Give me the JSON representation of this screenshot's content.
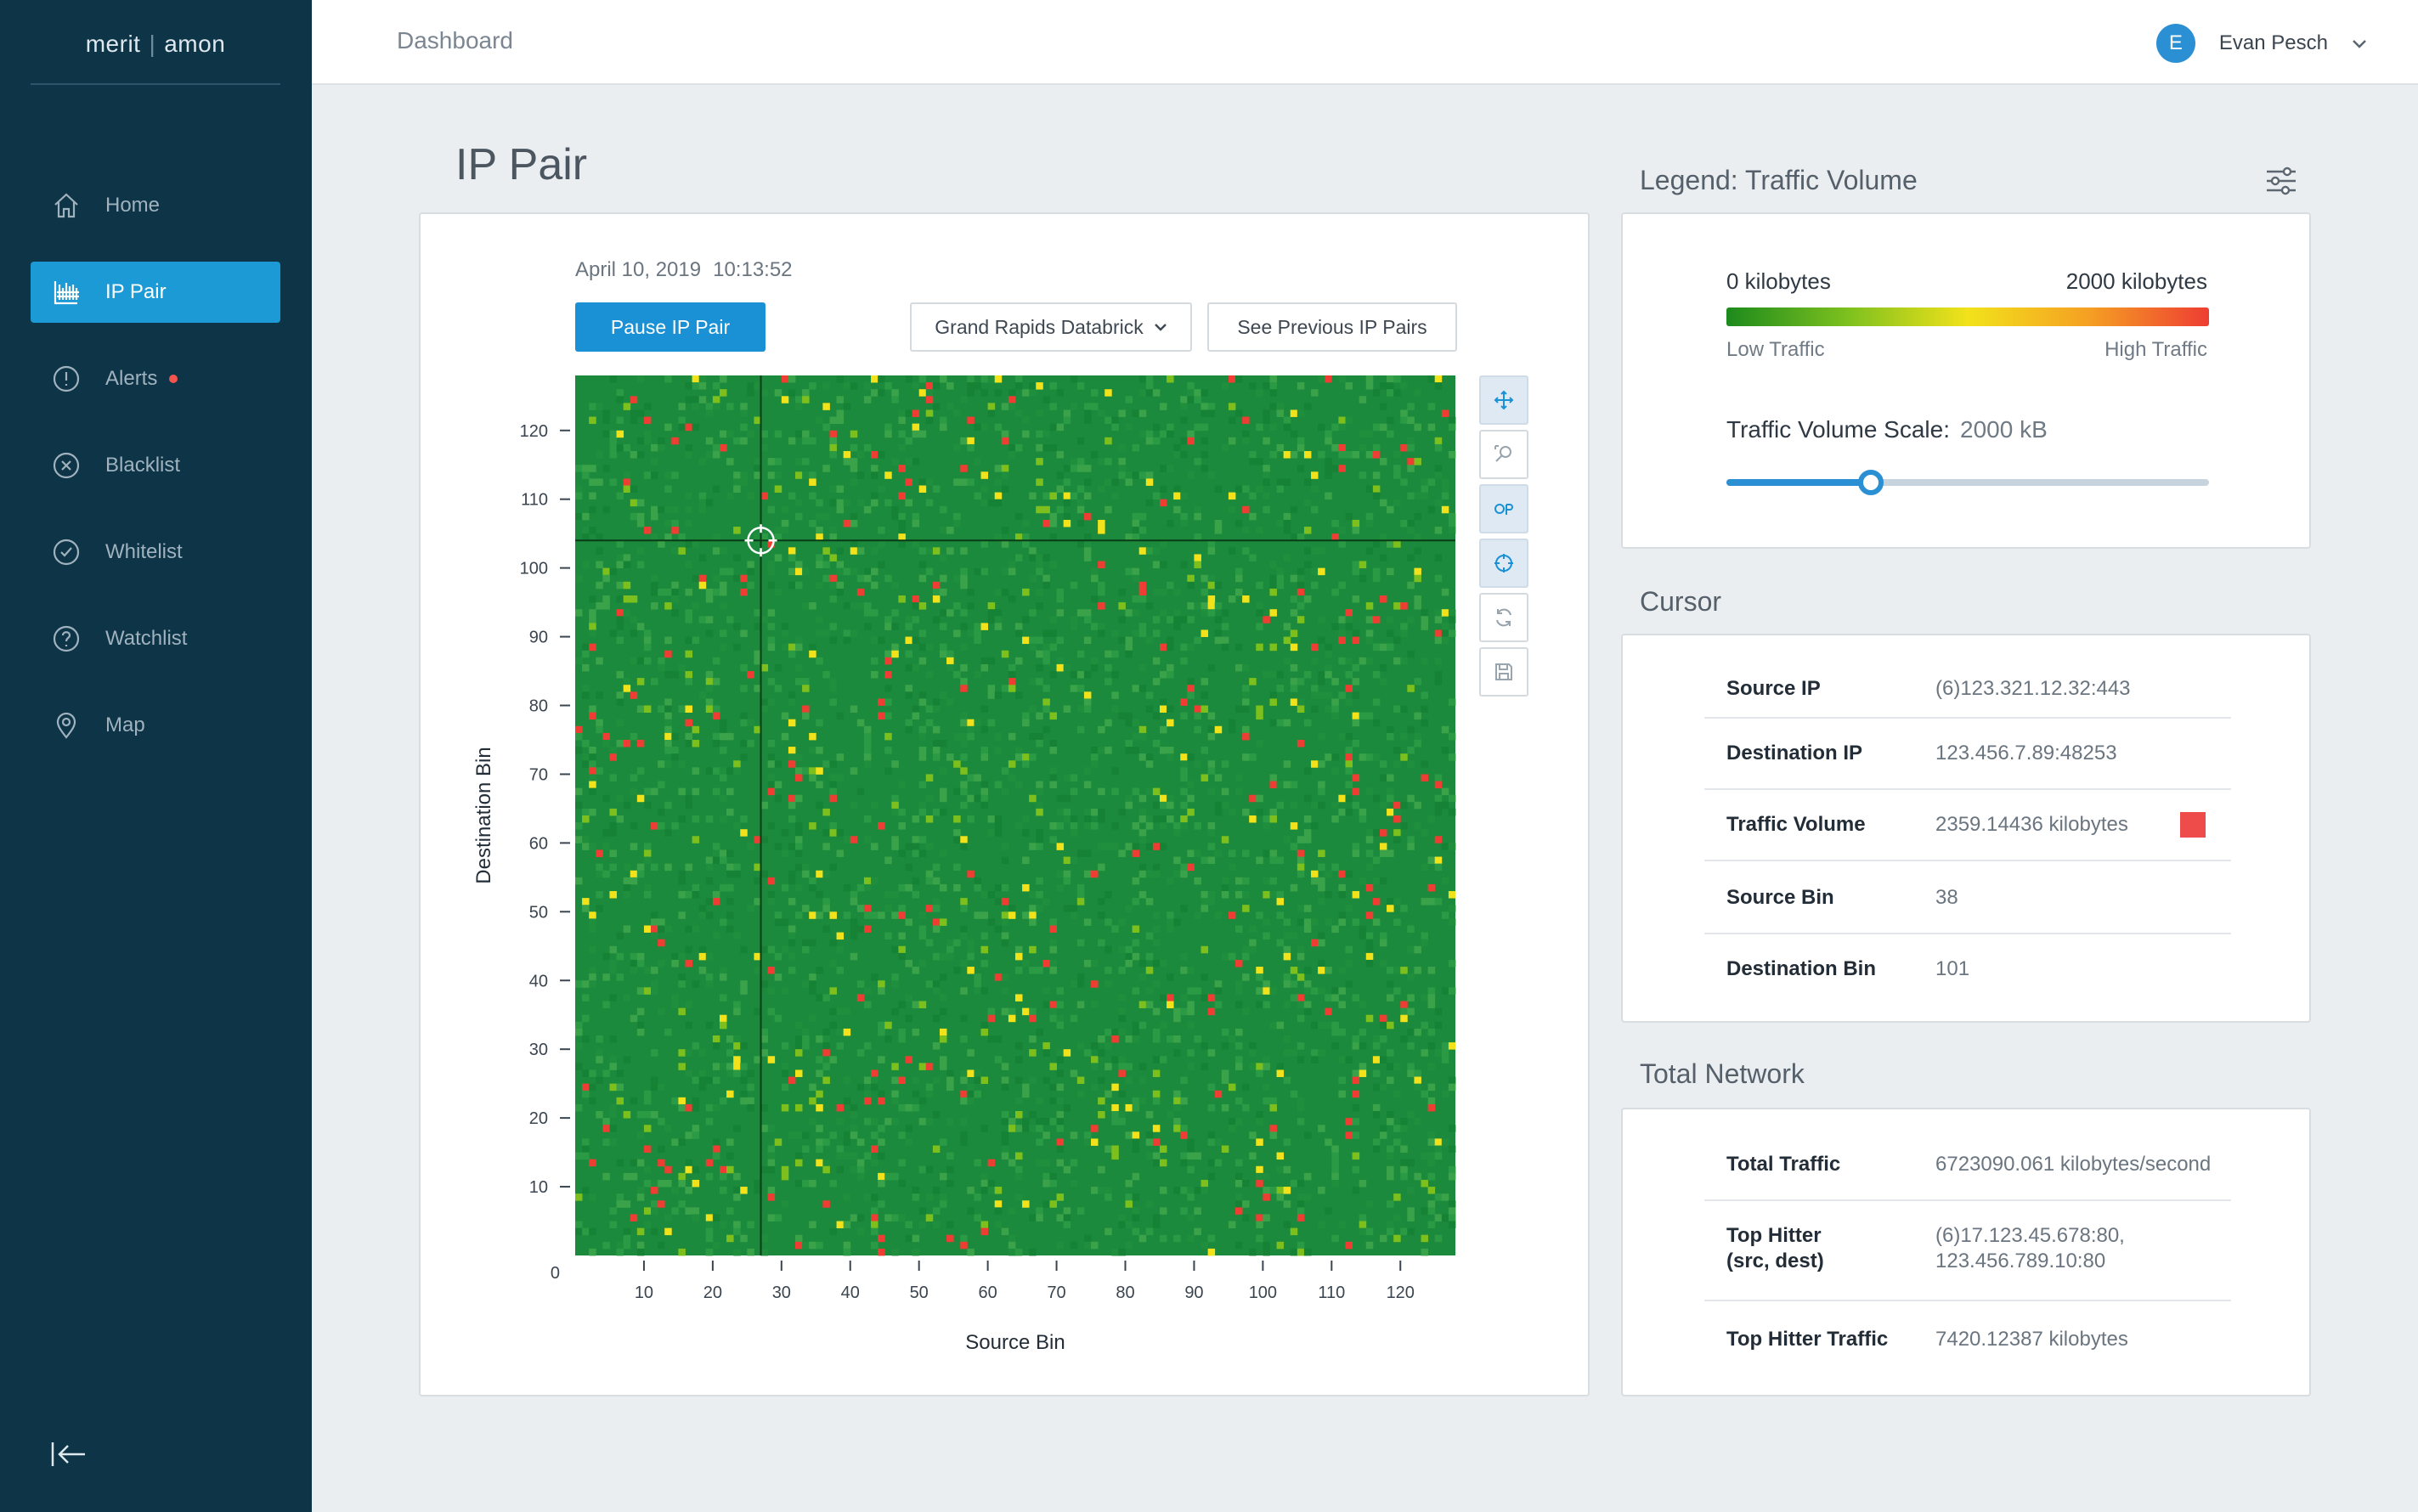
{
  "app": {
    "logo_left": "merit",
    "logo_sep": "|",
    "logo_right": "amon"
  },
  "sidebar": {
    "items": [
      {
        "label": "Home",
        "icon": "home-icon"
      },
      {
        "label": "IP Pair",
        "icon": "ip-pair-icon",
        "active": true
      },
      {
        "label": "Alerts",
        "icon": "alert-icon",
        "badge": true
      },
      {
        "label": "Blacklist",
        "icon": "x-circle-icon"
      },
      {
        "label": "Whitelist",
        "icon": "check-circle-icon"
      },
      {
        "label": "Watchlist",
        "icon": "question-circle-icon"
      },
      {
        "label": "Map",
        "icon": "map-pin-icon"
      }
    ],
    "collapse_icon": "collapse-left-icon"
  },
  "topbar": {
    "breadcrumb": "Dashboard",
    "user_initial": "E",
    "user_name": "Evan Pesch"
  },
  "page": {
    "title": "IP Pair"
  },
  "main": {
    "date": "April 10, 2019",
    "time": "10:13:52",
    "pause_label": "Pause IP Pair",
    "source_select": "Grand Rapids Databrick",
    "previous_label": "See Previous IP Pairs"
  },
  "chart_data": {
    "type": "heatmap",
    "xlabel": "Source Bin",
    "ylabel": "Destination Bin",
    "xlim": [
      0,
      128
    ],
    "ylim": [
      0,
      128
    ],
    "x_ticks": [
      10,
      20,
      30,
      40,
      50,
      60,
      70,
      80,
      90,
      100,
      110,
      120
    ],
    "y_ticks": [
      0,
      10,
      20,
      30,
      40,
      50,
      60,
      70,
      80,
      90,
      100,
      110,
      120
    ],
    "bins": 128,
    "value_range": [
      0,
      2000
    ],
    "value_unit": "kilobytes",
    "colors": [
      "#1c8a3c",
      "#7dc01e",
      "#f2e21b",
      "#ee3d33"
    ],
    "crosshair": {
      "x": 27,
      "y": 104
    }
  },
  "tools": [
    "pan-icon",
    "zoom-icon",
    "link-icon",
    "crosshair-icon",
    "reset-icon",
    "save-icon"
  ],
  "legend": {
    "title": "Legend: Traffic Volume",
    "min_label": "0 kilobytes",
    "max_label": "2000 kilobytes",
    "low_label": "Low Traffic",
    "high_label": "High Traffic",
    "scale_label": "Traffic Volume Scale:",
    "scale_value": "2000 kB",
    "slider_fraction": 0.3
  },
  "cursor": {
    "title": "Cursor",
    "rows": [
      {
        "k": "Source IP",
        "v": "(6)123.321.12.32:443"
      },
      {
        "k": "Destination IP",
        "v": "123.456.7.89:48253"
      },
      {
        "k": "Traffic Volume",
        "v": "2359.14436 kilobytes",
        "swatch": "#ee4b4b"
      },
      {
        "k": "Source Bin",
        "v": "38"
      },
      {
        "k": "Destination Bin",
        "v": "101"
      }
    ]
  },
  "network": {
    "title": "Total Network",
    "rows": [
      {
        "k": "Total Traffic",
        "v": "6723090.061 kilobytes/second"
      },
      {
        "k1": "Top Hitter",
        "k2": "(src, dest)",
        "v1": "(6)17.123.45.678:80,",
        "v2": "123.456.789.10:80"
      },
      {
        "k": "Top Hitter Traffic",
        "v": "7420.12387 kilobytes"
      }
    ]
  }
}
